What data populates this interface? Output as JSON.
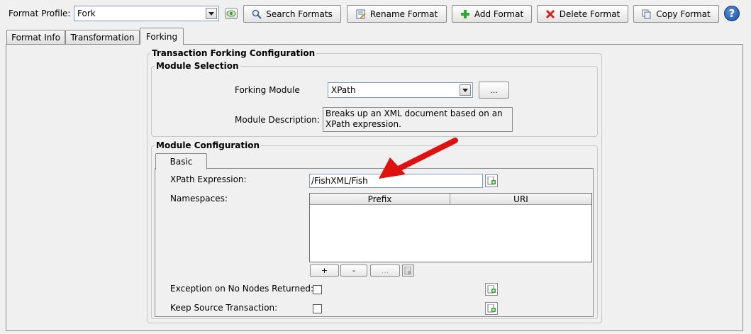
{
  "toolbar": {
    "format_profile_label": "Format Profile:",
    "format_profile_value": "Fork",
    "search_label": "Search Formats",
    "rename_label": "Rename Format",
    "add_label": "Add Format",
    "delete_label": "Delete Format",
    "copy_label": "Copy Format",
    "help_glyph": "?"
  },
  "tabs": [
    {
      "label": "Format Info",
      "active": false
    },
    {
      "label": "Transformation",
      "active": false
    },
    {
      "label": "Forking",
      "active": true
    }
  ],
  "forking": {
    "title": "Transaction Forking Configuration",
    "module_selection": {
      "title": "Module Selection",
      "forking_module_label": "Forking Module",
      "forking_module_value": "XPath",
      "browse_label": "...",
      "module_description_label": "Module Description:",
      "module_description_line1": "Breaks up an XML document based on an",
      "module_description_line2": "XPath expression."
    },
    "module_configuration": {
      "title": "Module Configuration",
      "subtab": "Basic",
      "xpath_label": "XPath Expression:",
      "xpath_value": "/FishXML/Fish",
      "namespaces_label": "Namespaces:",
      "columns": [
        "Prefix",
        "URI"
      ],
      "rows": [],
      "buttons": {
        "add": "+",
        "remove": "-",
        "edit": "..."
      },
      "exception_label": "Exception on No Nodes Returned:",
      "exception_checked": false,
      "keep_source_label": "Keep Source Transaction:",
      "keep_source_checked": false
    }
  },
  "colors": {
    "annotation_arrow": "#e01010",
    "add_icon_green": "#2eaa2e",
    "delete_icon_red": "#d42020",
    "help_blue": "#1a4fa0"
  }
}
